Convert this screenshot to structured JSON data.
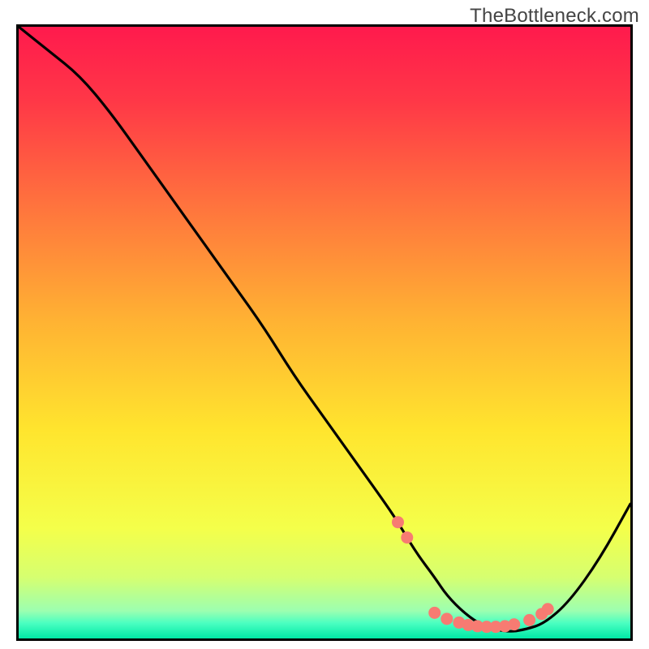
{
  "watermark": "TheBottleneck.com",
  "chart_data": {
    "type": "line",
    "title": "",
    "xlabel": "",
    "ylabel": "",
    "xlim": [
      0,
      100
    ],
    "ylim": [
      0,
      100
    ],
    "grid": false,
    "curve": {
      "name": "bottleneck-curve",
      "x": [
        0,
        5,
        10,
        15,
        20,
        25,
        30,
        35,
        40,
        45,
        50,
        55,
        60,
        62,
        65,
        68,
        70,
        73,
        76,
        80,
        83,
        86,
        90,
        95,
        100
      ],
      "y": [
        100,
        96,
        92,
        86,
        79,
        72,
        65,
        58,
        51,
        43,
        36,
        29,
        22,
        19,
        14,
        10,
        7,
        4,
        2,
        1,
        1.5,
        2.5,
        6,
        13,
        22
      ]
    },
    "markers": {
      "name": "accent-dots",
      "color": "#f77b72",
      "x": [
        62,
        63.5,
        68,
        70,
        72,
        73.5,
        75,
        76.5,
        78,
        79.5,
        81,
        83.5,
        85.5,
        86.5
      ],
      "y": [
        19,
        16.5,
        4.2,
        3.2,
        2.6,
        2.2,
        2.0,
        1.9,
        1.9,
        2.0,
        2.3,
        3.0,
        4.0,
        4.8
      ]
    },
    "background_gradient": {
      "stops": [
        {
          "offset": 0.0,
          "color": "#ff1a4d"
        },
        {
          "offset": 0.12,
          "color": "#ff3747"
        },
        {
          "offset": 0.3,
          "color": "#ff763d"
        },
        {
          "offset": 0.48,
          "color": "#ffb233"
        },
        {
          "offset": 0.66,
          "color": "#ffe52e"
        },
        {
          "offset": 0.82,
          "color": "#f4ff4a"
        },
        {
          "offset": 0.9,
          "color": "#d6ff70"
        },
        {
          "offset": 0.955,
          "color": "#9cffb0"
        },
        {
          "offset": 0.975,
          "color": "#4affc1"
        },
        {
          "offset": 1.0,
          "color": "#00e8a6"
        }
      ]
    }
  }
}
